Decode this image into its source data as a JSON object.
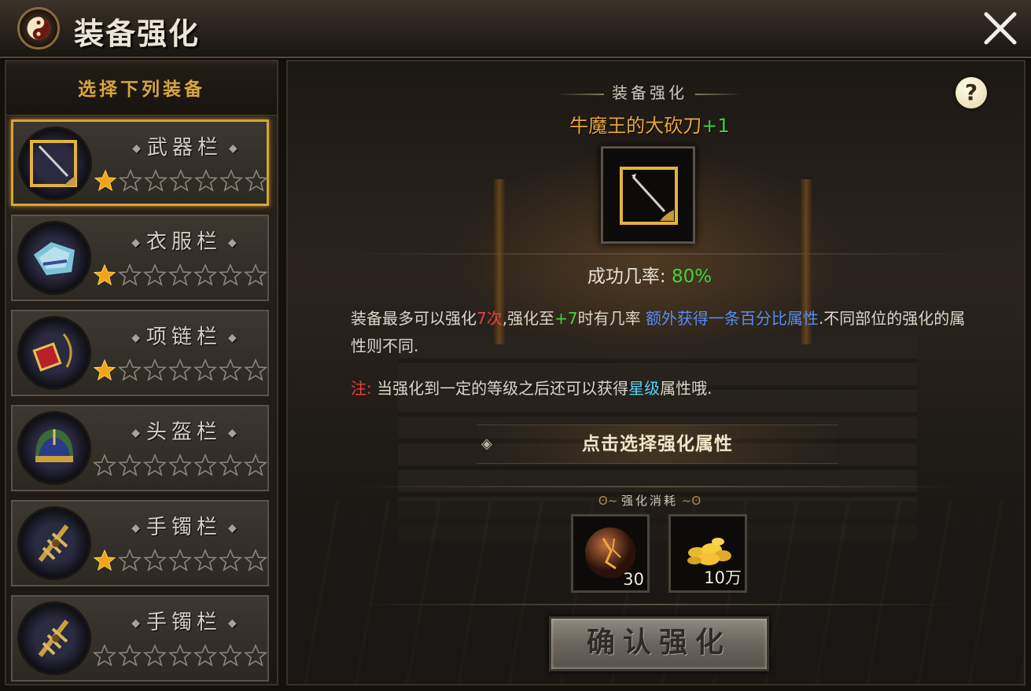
{
  "window": {
    "title": "装备强化",
    "close_icon": "close-icon",
    "emblem_icon": "taiji-emblem-icon"
  },
  "left_panel": {
    "header": "选择下列装备",
    "slots": [
      {
        "name": "武器栏",
        "icon": "sword-icon",
        "stars_filled": 1,
        "stars_total": 7,
        "selected": true
      },
      {
        "name": "衣服栏",
        "icon": "armor-icon",
        "stars_filled": 1,
        "stars_total": 7,
        "selected": false
      },
      {
        "name": "项链栏",
        "icon": "necklace-icon",
        "stars_filled": 1,
        "stars_total": 7,
        "selected": false
      },
      {
        "name": "头盔栏",
        "icon": "helmet-icon",
        "stars_filled": 0,
        "stars_total": 7,
        "selected": false
      },
      {
        "name": "手镯栏",
        "icon": "bracelet-icon",
        "stars_filled": 1,
        "stars_total": 7,
        "selected": false
      },
      {
        "name": "手镯栏",
        "icon": "bracelet-icon",
        "stars_filled": 0,
        "stars_total": 7,
        "selected": false
      }
    ]
  },
  "main": {
    "section_title": "装备强化",
    "item_name": "牛魔王的大砍刀",
    "item_plus": "+1",
    "success_label": "成功几率:",
    "success_value": "80%",
    "desc": {
      "p1": "装备最多可以强化",
      "times": "7次",
      "p2": ",强化至",
      "level": "+7",
      "p3": "时有几率 ",
      "bonus": "额外获得一条百分比属性",
      "p4": ".不同部位的强化的属性则不同."
    },
    "note": {
      "label": "注:",
      "text1": "当强化到一定的等级之后还可以获得",
      "star": "星级",
      "text2": "属性哦."
    },
    "select_attr_label": "点击选择强化属性",
    "cost_title": "强化消耗",
    "costs": [
      {
        "icon": "stone-icon",
        "qty": "30"
      },
      {
        "icon": "gold-coins-icon",
        "qty": "10万"
      }
    ],
    "confirm_label": "确认强化",
    "help_label": "?"
  },
  "colors": {
    "accent_gold": "#d6a33a",
    "success_green": "#3ed43e",
    "warning_red": "#e8403c",
    "link_blue": "#5a8af0",
    "star_cyan": "#5ad0f0"
  }
}
